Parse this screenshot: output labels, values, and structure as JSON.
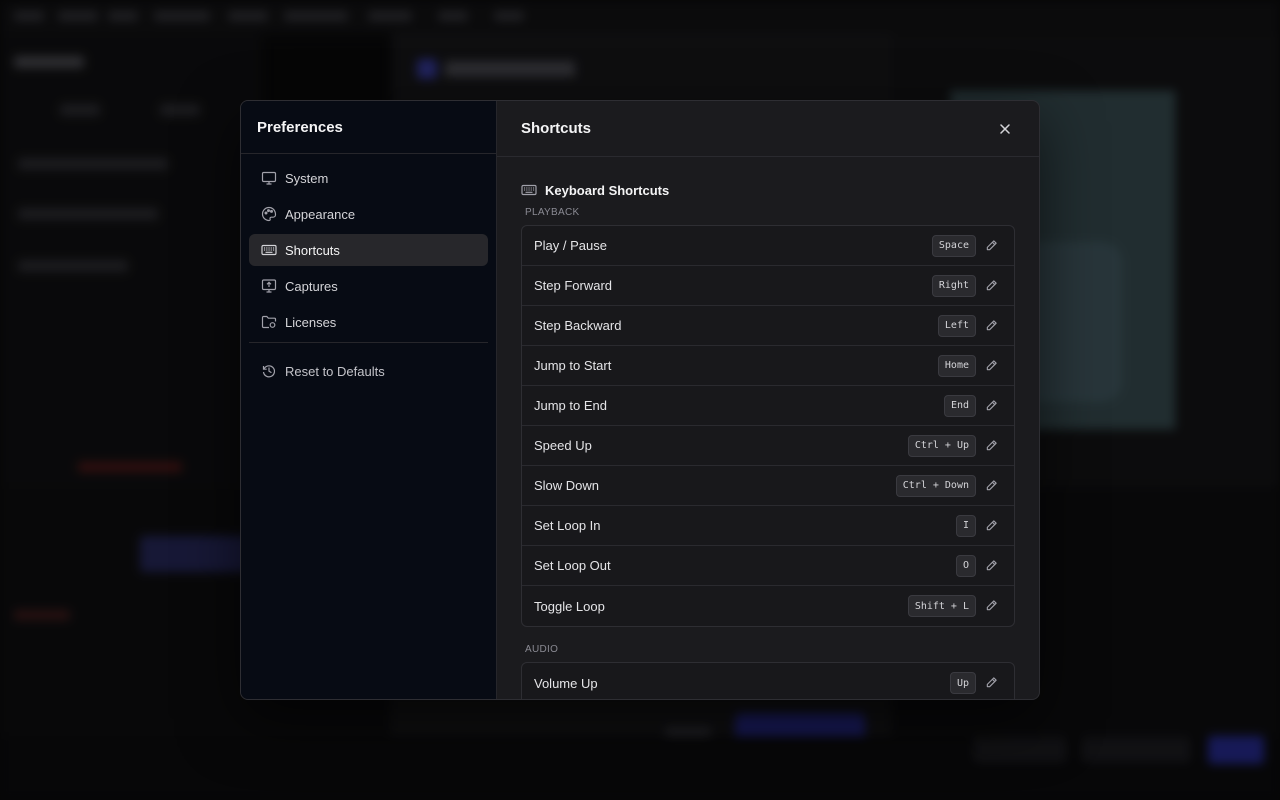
{
  "colors": {
    "accent": "#2a2f9e",
    "modal_bg": "#1b1b1e",
    "sidebar_bg": "#070b14"
  },
  "sidebar": {
    "title": "Preferences",
    "items": [
      {
        "label": "System",
        "icon": "monitor-icon",
        "active": false
      },
      {
        "label": "Appearance",
        "icon": "palette-icon",
        "active": false
      },
      {
        "label": "Shortcuts",
        "icon": "keyboard-icon",
        "active": true
      },
      {
        "label": "Captures",
        "icon": "capture-icon",
        "active": false
      },
      {
        "label": "Licenses",
        "icon": "folder-license-icon",
        "active": false
      }
    ],
    "reset_label": "Reset to Defaults"
  },
  "content": {
    "title": "Shortcuts",
    "section_title": "Keyboard Shortcuts",
    "groups": [
      {
        "label": "Playback",
        "shortcuts": [
          {
            "action": "Play / Pause",
            "keys": "Space"
          },
          {
            "action": "Step Forward",
            "keys": "Right"
          },
          {
            "action": "Step Backward",
            "keys": "Left"
          },
          {
            "action": "Jump to Start",
            "keys": "Home"
          },
          {
            "action": "Jump to End",
            "keys": "End"
          },
          {
            "action": "Speed Up",
            "keys": "Ctrl + Up"
          },
          {
            "action": "Slow Down",
            "keys": "Ctrl + Down"
          },
          {
            "action": "Set Loop In",
            "keys": "I"
          },
          {
            "action": "Set Loop Out",
            "keys": "O"
          },
          {
            "action": "Toggle Loop",
            "keys": "Shift + L"
          }
        ]
      },
      {
        "label": "Audio",
        "shortcuts": [
          {
            "action": "Volume Up",
            "keys": "Up"
          }
        ]
      }
    ]
  }
}
